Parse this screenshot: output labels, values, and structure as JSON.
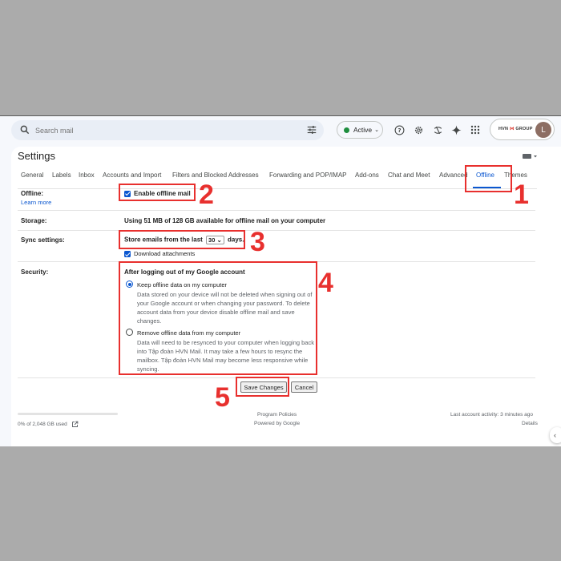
{
  "search": {
    "placeholder": "Search mail"
  },
  "status": {
    "label": "Active"
  },
  "icons": [
    "search-icon",
    "tune-icon",
    "help-icon",
    "settings-icon",
    "google-apps-script-icon",
    "gemini-sparkle-icon",
    "apps-grid-icon"
  ],
  "account": {
    "logo_text_a": "HVN",
    "logo_text_b": "GROUP",
    "avatar_letter": "L"
  },
  "page": {
    "title": "Settings"
  },
  "tabs": [
    "General",
    "Labels",
    "Inbox",
    "Accounts and Import",
    "Filters and Blocked Addresses",
    "Forwarding and POP/IMAP",
    "Add-ons",
    "Chat and Meet",
    "Advanced",
    "Offline",
    "Themes"
  ],
  "selected_tab": "Offline",
  "offline": {
    "label": "Offline:",
    "learn_more": "Learn more",
    "enable_label": "Enable offline mail",
    "enabled": true
  },
  "storage": {
    "label": "Storage:",
    "text": "Using 51 MB of 128 GB available for offline mail on your computer"
  },
  "sync": {
    "label": "Sync settings:",
    "prefix": "Store emails from the last",
    "days_value": "30",
    "suffix": "days.",
    "download_attachments": "Download attachments"
  },
  "security": {
    "label": "Security:",
    "heading": "After logging out of my Google account",
    "keep_label": "Keep offline data on my computer",
    "keep_desc": "Data stored on your device will not be deleted when signing out of your Google account or when changing your password. To delete account data from your device disable offline mail and save changes.",
    "remove_label": "Remove offline data from my computer",
    "remove_desc": "Data will need to be resynced to your computer when logging back into Tập đoàn HVN Mail. It may take a few hours to resync the mailbox. Tập đoàn HVN Mail may become less responsive while syncing.",
    "selected": "keep"
  },
  "buttons": {
    "save": "Save Changes",
    "cancel": "Cancel"
  },
  "footer": {
    "usage": "0% of 2,048 GB used",
    "policies": "Program Policies",
    "powered": "Powered by Google",
    "activity": "Last account activity: 3 minutes ago",
    "details": "Details"
  },
  "annotations": [
    "1",
    "2",
    "3",
    "4",
    "5"
  ],
  "colors": {
    "annotation": "#e8302e",
    "accent": "#0b57d0",
    "active_dot": "#1e8e3e"
  }
}
